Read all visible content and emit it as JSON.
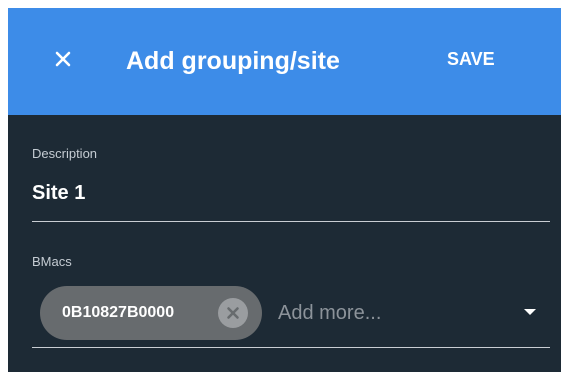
{
  "header": {
    "title": "Add grouping/site",
    "save_label": "SAVE",
    "close_icon": "close-icon",
    "background_color": "#3d8ce8"
  },
  "description_field": {
    "label": "Description",
    "value": "Site 1"
  },
  "bmacs_field": {
    "label": "BMacs",
    "chips": [
      {
        "label": "0B10827B0000",
        "remove_icon": "cancel-circle-icon"
      }
    ],
    "placeholder": "Add more...",
    "dropdown_icon": "caret-down-icon"
  },
  "colors": {
    "panel_background": "#1d2a35",
    "chip_background": "#676b6e"
  }
}
